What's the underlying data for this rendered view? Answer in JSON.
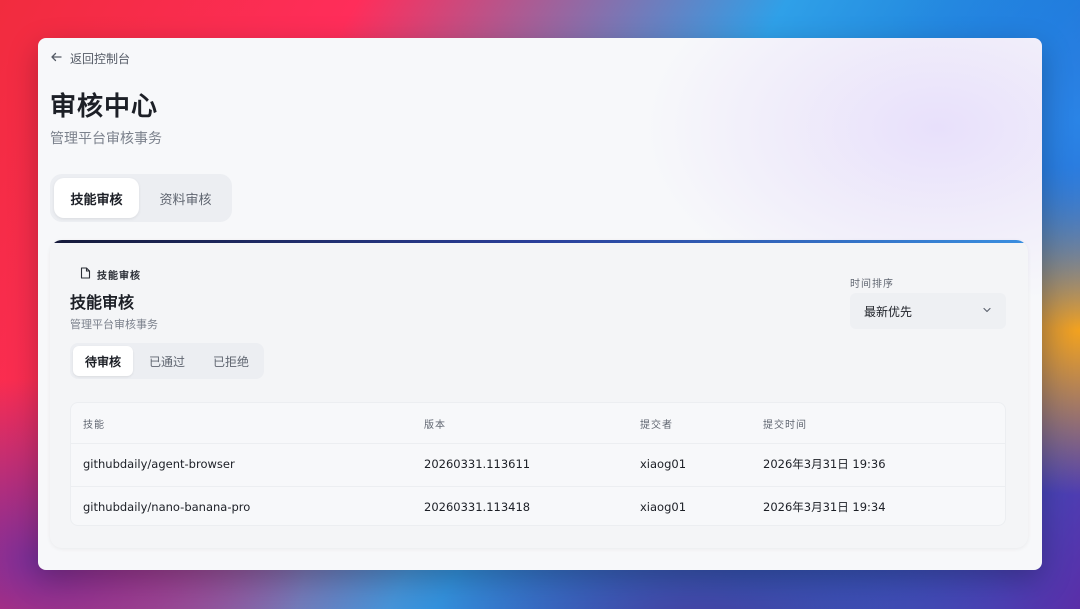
{
  "back_link": {
    "label": "返回控制台",
    "icon": "arrow-left-icon"
  },
  "page": {
    "title": "审核中心",
    "subtitle": "管理平台审核事务"
  },
  "main_tabs": [
    {
      "label": "技能审核",
      "active": true
    },
    {
      "label": "资料审核",
      "active": false
    }
  ],
  "card": {
    "tag": {
      "label": "技能审核",
      "icon": "document-icon"
    },
    "title": "技能审核",
    "subtitle": "管理平台审核事务",
    "sort": {
      "label": "时间排序",
      "value": "最新优先",
      "icon": "chevron-down-icon"
    },
    "status_tabs": [
      {
        "label": "待审核",
        "active": true
      },
      {
        "label": "已通过",
        "active": false
      },
      {
        "label": "已拒绝",
        "active": false
      }
    ],
    "table": {
      "columns": [
        "技能",
        "版本",
        "提交者",
        "提交时间"
      ],
      "rows": [
        [
          "githubdaily/agent-browser",
          "20260331.113611",
          "xiaog01",
          "2026年3月31日 19:36"
        ],
        [
          "githubdaily/nano-banana-pro",
          "20260331.113418",
          "xiaog01",
          "2026年3月31日 19:34"
        ]
      ]
    }
  },
  "colors": {
    "accent_gradient_start": "#151a3a",
    "accent_gradient_end": "#3a8fe0",
    "text_primary": "#1c1f26",
    "text_secondary": "#7b818c"
  }
}
